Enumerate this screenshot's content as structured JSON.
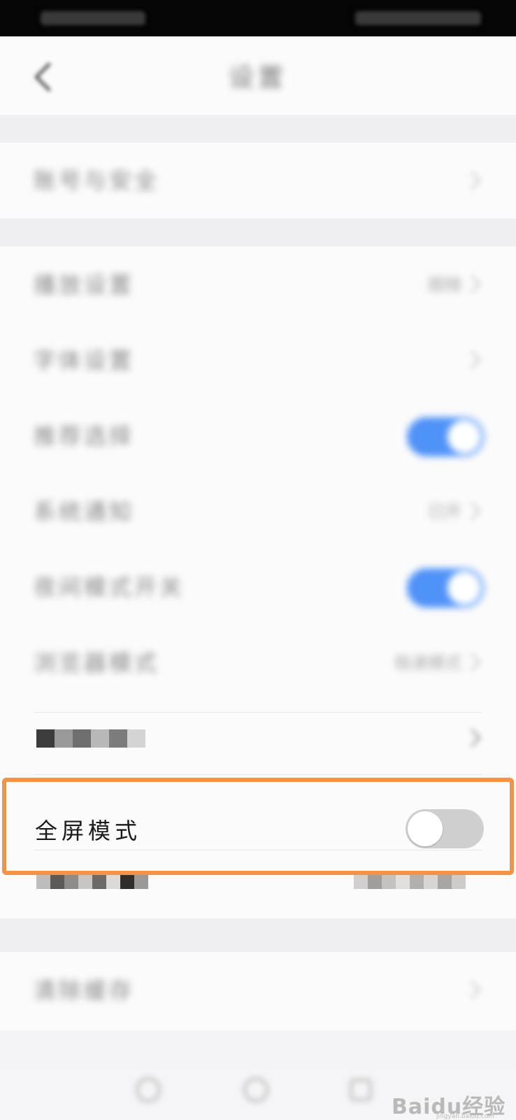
{
  "header": {
    "title": "设置"
  },
  "group1": {
    "items": [
      {
        "label": "账号与安全"
      }
    ]
  },
  "group2": {
    "items": [
      {
        "label": "播放设置",
        "value": "跟随"
      },
      {
        "label": "字体设置",
        "value": ""
      },
      {
        "label": "推荐选择",
        "toggle": true
      },
      {
        "label": "系统通知",
        "value": "已开"
      },
      {
        "label": "夜间模式开关",
        "toggle": true
      },
      {
        "label": "浏览器模式",
        "value": "极速模式"
      }
    ]
  },
  "full_screen": {
    "label": "全屏模式",
    "toggle": false
  },
  "group3": {
    "items": [
      {
        "label": "清除缓存"
      }
    ]
  },
  "watermark": {
    "text": "Baidu经验",
    "sub": "jingyan.baidu.com"
  },
  "colors": {
    "accent": "#4f92f8",
    "highlight": "#f0944b",
    "toggle_off": "#cfcfcf"
  },
  "icons": [
    "back-icon",
    "chevron-right-icon",
    "home-icon",
    "compass-icon",
    "profile-icon"
  ]
}
